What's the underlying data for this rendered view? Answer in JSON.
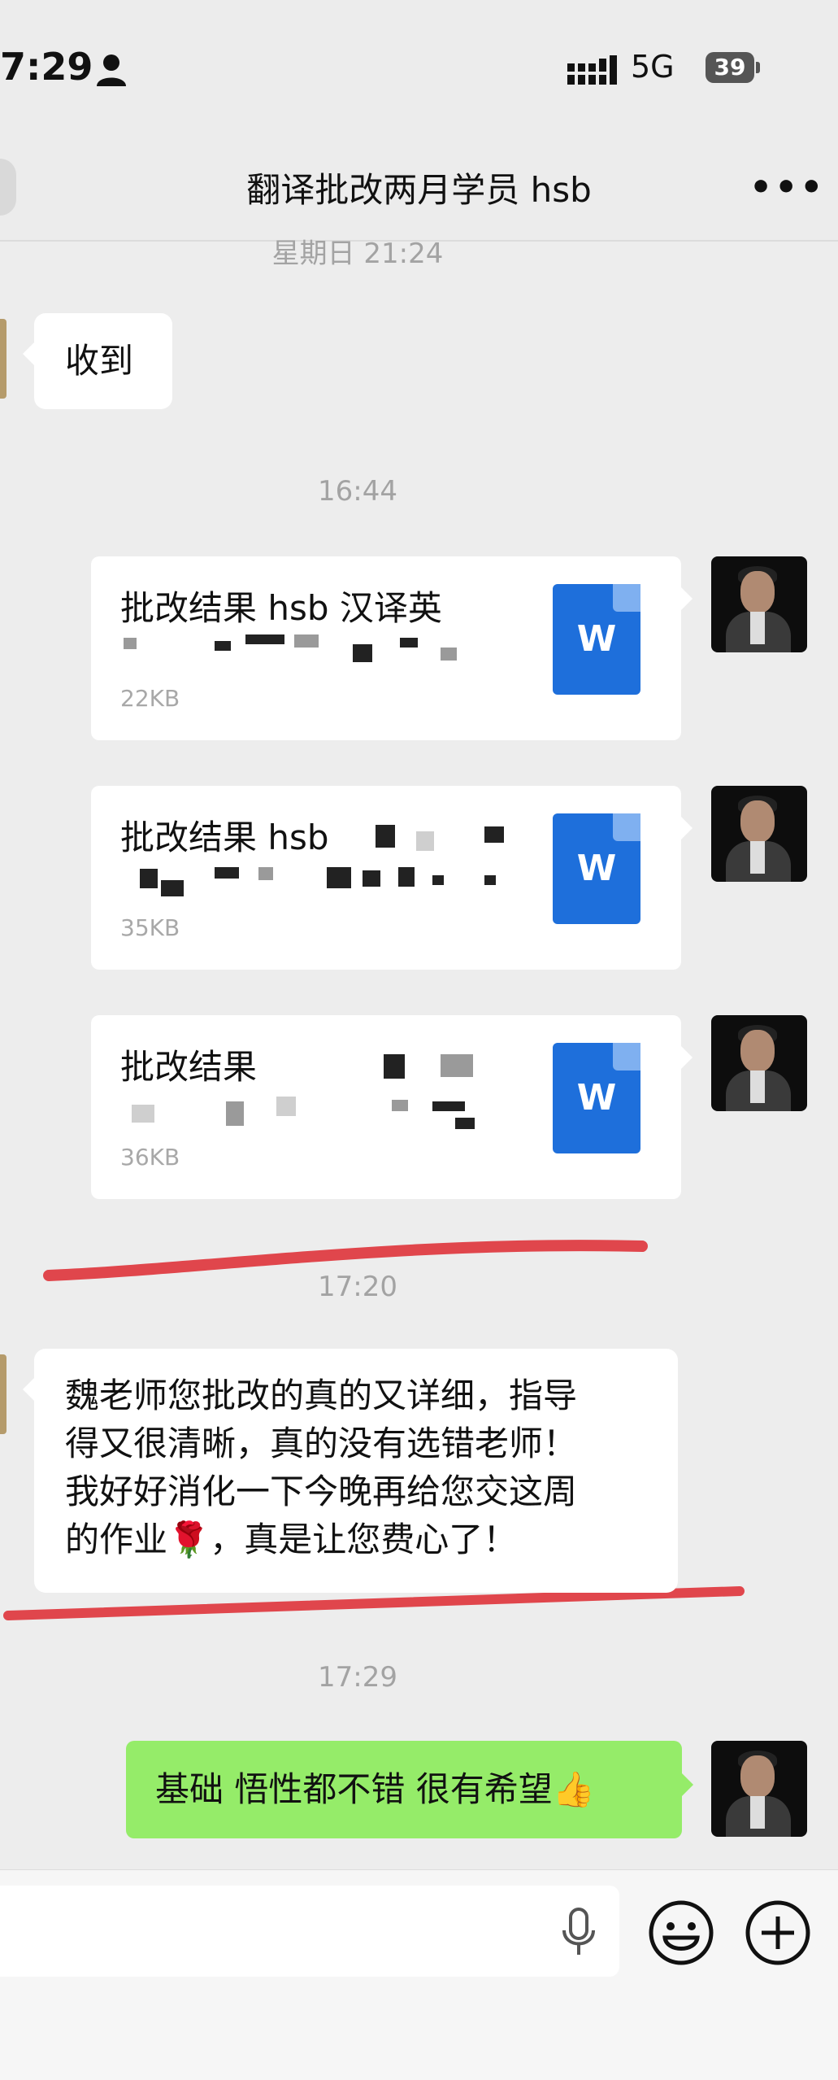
{
  "status_bar": {
    "time": "7:29",
    "network": "5G",
    "battery": "39"
  },
  "header": {
    "title": "翻译批改两月学员 hsb",
    "more": "•••"
  },
  "timestamps": [
    "星期日 21:24",
    "16:44",
    "17:20",
    "17:29"
  ],
  "messages": {
    "received_1": "收到",
    "files": [
      {
        "name": "批改结果 hsb 汉译英",
        "size": "22KB"
      },
      {
        "name": "批改结果 hsb",
        "size": "35KB"
      },
      {
        "name": "批改结果",
        "size": "36KB"
      }
    ],
    "file_icon_letter": "W",
    "received_2_lines": [
      "魏老师您批改的真的又详细，指导",
      "得又很清晰，真的没有选错老师！",
      "我好好消化一下今晚再给您交这周",
      "的作业🌹，真是让您费心了！"
    ],
    "sent_1": "基础 悟性都不错 很有希望👍"
  },
  "colors": {
    "background": "#ededed",
    "sent_bubble": "#95ec69",
    "word_icon": "#1e6fdb",
    "annotation_red": "#e0464c"
  },
  "icons": [
    "person-icon",
    "signal-icon",
    "more-icon",
    "word-file-icon",
    "mic-icon",
    "emoji-icon",
    "plus-icon"
  ]
}
